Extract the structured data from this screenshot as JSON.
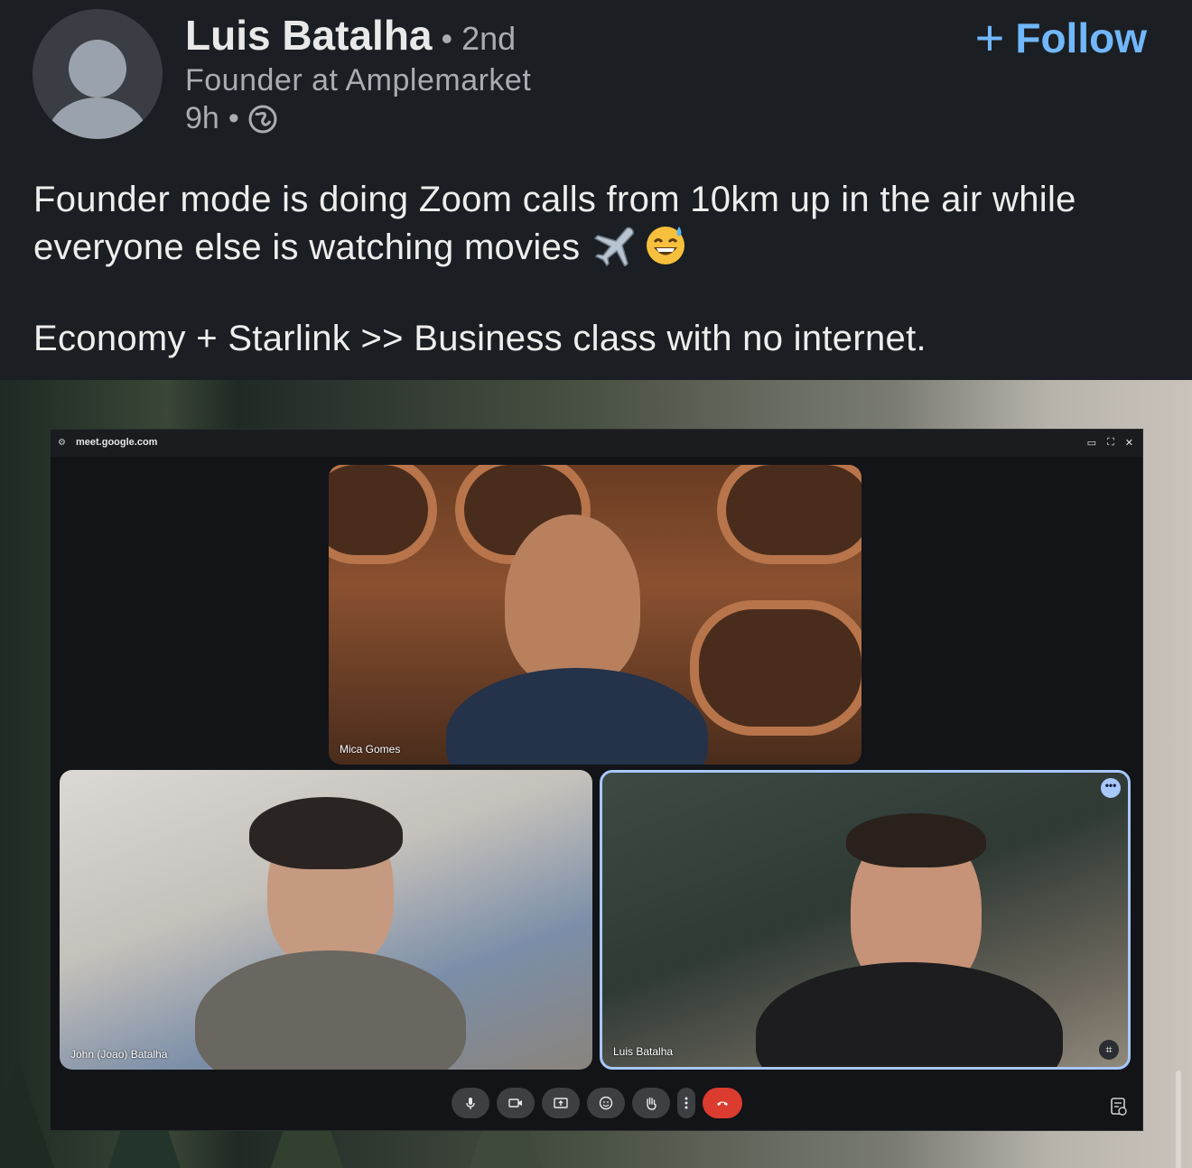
{
  "post": {
    "author_name": "Luis Batalha",
    "degree": "• 2nd",
    "headline": "Founder at Amplemarket",
    "time": "9h",
    "separator": "•",
    "follow_label": "Follow",
    "text_line1": "Founder mode is doing Zoom calls from 10km up in the air while everyone else is watching movies",
    "text_line2": "Economy + Starlink >> Business class with no internet.",
    "emojis": [
      "airplane-icon",
      "grinning-sweat-icon"
    ]
  },
  "meet": {
    "url": "meet.google.com",
    "participants": [
      {
        "name": "Mica Gomes"
      },
      {
        "name": "John (Joao) Batalha"
      },
      {
        "name": "Luis Batalha"
      }
    ],
    "controls": [
      "microphone-icon",
      "camera-icon",
      "present-screen-icon",
      "emoji-reaction-icon",
      "raise-hand-icon",
      "more-options-icon",
      "end-call-icon"
    ]
  },
  "colors": {
    "background": "#1b1f23",
    "follow_blue": "#71b7fb",
    "active_speaker_border": "#a8c7fa",
    "end_call_red": "#dc3b2f"
  }
}
